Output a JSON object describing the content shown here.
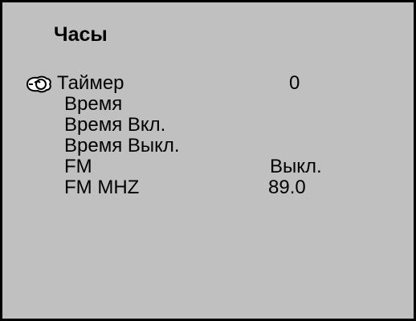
{
  "screen": {
    "title": "Часы",
    "accent_colors": {
      "background": "#c0c0c0",
      "text": "#000000",
      "border": "#000000"
    }
  },
  "menu": {
    "cursor_icon": "cursor-pointer-icon",
    "items": [
      {
        "label": "Таймер",
        "value": "0",
        "selected": true
      },
      {
        "label": "Время",
        "value": ""
      },
      {
        "label": "Время Вкл.",
        "value": ""
      },
      {
        "label": "Время Выкл.",
        "value": ""
      },
      {
        "label": "FM",
        "value": "Выкл."
      },
      {
        "label": "FM MHZ",
        "value": "89.0"
      }
    ]
  }
}
